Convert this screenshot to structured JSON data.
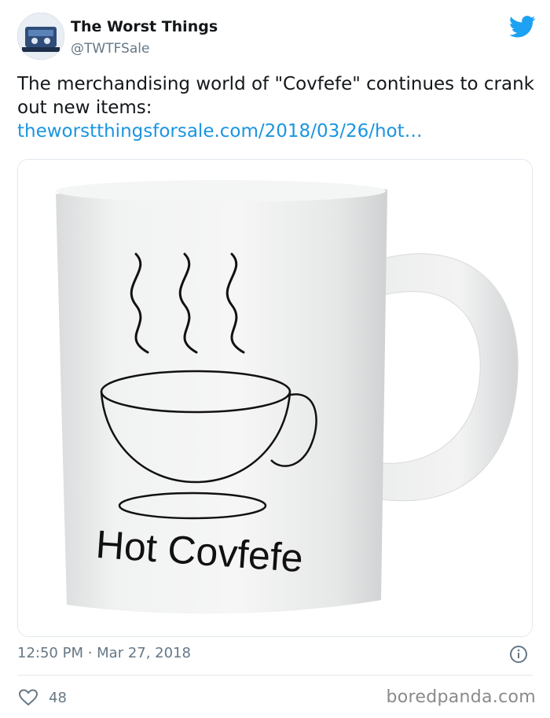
{
  "author": {
    "name": "The Worst Things",
    "handle": "@TWTFSale"
  },
  "tweet": {
    "text": "The merchandising world of \"Covfefe\" continues to crank out new items:",
    "link": "theworstthingsforsale.com/2018/03/26/hot…"
  },
  "media": {
    "mug_label": "Hot Covfefe"
  },
  "meta": {
    "time": "12:50 PM · Mar 27, 2018"
  },
  "actions": {
    "like_count": "48"
  },
  "watermark": "boredpanda.com",
  "colors": {
    "link": "#1b95e0",
    "twitter_blue": "#1da1f2",
    "muted": "#657786"
  },
  "icons": [
    "twitter-bird-icon",
    "info-icon",
    "heart-icon"
  ]
}
